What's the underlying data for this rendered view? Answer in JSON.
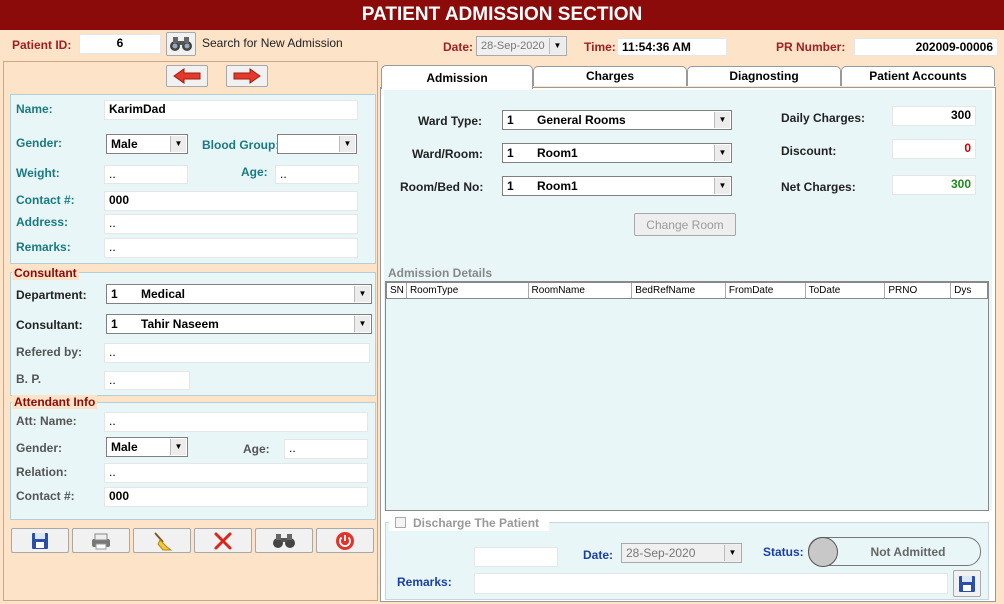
{
  "app": {
    "title": "PATIENT ADMISSION SECTION"
  },
  "header": {
    "patient_id_label": "Patient ID:",
    "patient_id_value": "6",
    "search_label": "Search for New Admission",
    "date_label": "Date:",
    "date_value": "28-Sep-2020",
    "time_label": "Time:",
    "time_value": "11:54:36 AM",
    "pr_label": "PR Number:",
    "pr_value": "202009-00006"
  },
  "patient": {
    "name_label": "Name:",
    "name_value": "KarimDad",
    "gender_label": "Gender:",
    "gender_value": "Male",
    "blood_group_label": "Blood Group:",
    "blood_group_value": "",
    "weight_label": "Weight:",
    "weight_value": "..",
    "age_label": "Age:",
    "age_value": "..",
    "contact_label": "Contact #:",
    "contact_value": "000",
    "address_label": "Address:",
    "address_value": "..",
    "remarks_label": "Remarks:",
    "remarks_value": ".."
  },
  "consultant": {
    "group_title": "Consultant",
    "department_label": "Department:",
    "department_code": "1",
    "department_value": "Medical",
    "consultant_label": "Consultant:",
    "consultant_code": "1",
    "consultant_value": "Tahir Naseem",
    "refered_label": "Refered by:",
    "refered_value": "..",
    "bp_label": "B. P.",
    "bp_value": ".."
  },
  "attendant": {
    "group_title": "Attendant Info",
    "name_label": "Att: Name:",
    "name_value": "..",
    "gender_label": "Gender:",
    "gender_value": "Male",
    "age_label": "Age:",
    "age_value": "..",
    "relation_label": "Relation:",
    "relation_value": "..",
    "contact_label": "Contact #:",
    "contact_value": "000"
  },
  "tabs": [
    {
      "label": "Admission"
    },
    {
      "label": "Charges"
    },
    {
      "label": "Diagnosting"
    },
    {
      "label": "Patient Accounts"
    }
  ],
  "admission": {
    "ward_type_label": "Ward Type:",
    "ward_type_code": "1",
    "ward_type_value": "General Rooms",
    "ward_room_label": "Ward/Room:",
    "ward_room_code": "1",
    "ward_room_value": "Room1",
    "bed_label": "Room/Bed No:",
    "bed_code": "1",
    "bed_value": "Room1",
    "daily_label": "Daily Charges:",
    "daily_value": "300",
    "discount_label": "Discount:",
    "discount_value": "0",
    "net_label": "Net Charges:",
    "net_value": "300",
    "change_room_label": "Change Room",
    "details_label": "Admission Details",
    "columns": [
      "SN",
      "RoomType",
      "RoomName",
      "BedRefName",
      "FromDate",
      "ToDate",
      "PRNO",
      "Dys"
    ]
  },
  "discharge": {
    "checkbox_label": "Discharge The Patient",
    "date_label": "Date:",
    "date_value": "28-Sep-2020",
    "status_label": "Status:",
    "status_value": "Not Admitted",
    "remarks_label": "Remarks:"
  },
  "colors": {
    "title_bg": "#8b0a0a",
    "panel_bg": "#e9f6f8",
    "window_bg": "#fde3c8"
  }
}
